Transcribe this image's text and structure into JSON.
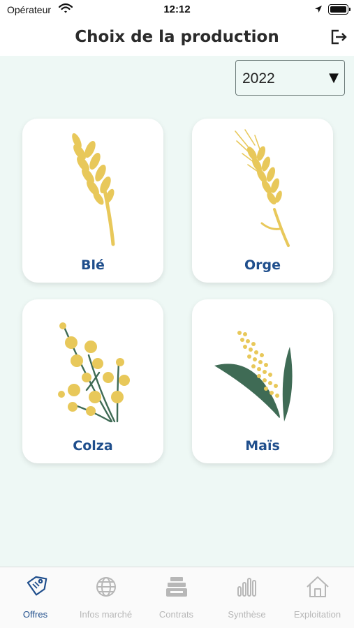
{
  "status_bar": {
    "carrier": "Opérateur",
    "time": "12:12"
  },
  "header": {
    "title": "Choix de la production"
  },
  "year_select": {
    "value": "2022",
    "arrow": "▼"
  },
  "productions": [
    {
      "label": "Blé",
      "icon": "wheat-icon"
    },
    {
      "label": "Orge",
      "icon": "barley-icon"
    },
    {
      "label": "Colza",
      "icon": "rapeseed-icon"
    },
    {
      "label": "Maïs",
      "icon": "corn-icon"
    }
  ],
  "tabs": [
    {
      "label": "Offres",
      "icon": "price-tag-icon",
      "active": true
    },
    {
      "label": "Infos marché",
      "icon": "globe-icon",
      "active": false
    },
    {
      "label": "Contrats",
      "icon": "contracts-icon",
      "active": false
    },
    {
      "label": "Synthèse",
      "icon": "bar-chart-icon",
      "active": false
    },
    {
      "label": "Exploitation",
      "icon": "house-icon",
      "active": false
    }
  ],
  "colors": {
    "accent": "#1f4e8c",
    "grain": "#e8c85a",
    "leaf": "#3f6b55",
    "background": "#eef8f5",
    "inactive_tab": "#b7b7b7"
  }
}
